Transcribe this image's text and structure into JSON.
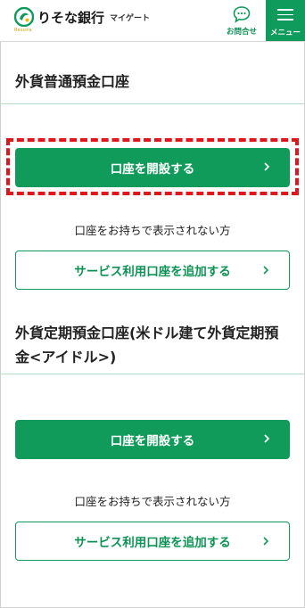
{
  "header": {
    "brand_name": "りそな銀行",
    "brand_sub": "マイゲート",
    "brand_tag": "Resona",
    "contact_label": "お問合せ",
    "menu_label": "メニュー"
  },
  "sections": [
    {
      "title": "外貨普通預金口座",
      "open_button": "口座を開設する",
      "note": "口座をお持ちで表示されない方",
      "add_button": "サービス利用口座を追加する"
    },
    {
      "title": "外貨定期預金口座(米ドル建て外貨定期預金<アイドル>)",
      "open_button": "口座を開設する",
      "note": "口座をお持ちで表示されない方",
      "add_button": "サービス利用口座を追加する"
    }
  ],
  "colors": {
    "brand_green": "#119b5b",
    "highlight_red": "#e2141c"
  },
  "icons": {
    "contact": "chat-bubble-icon",
    "menu": "hamburger-icon",
    "chevron": "chevron-right-icon"
  }
}
